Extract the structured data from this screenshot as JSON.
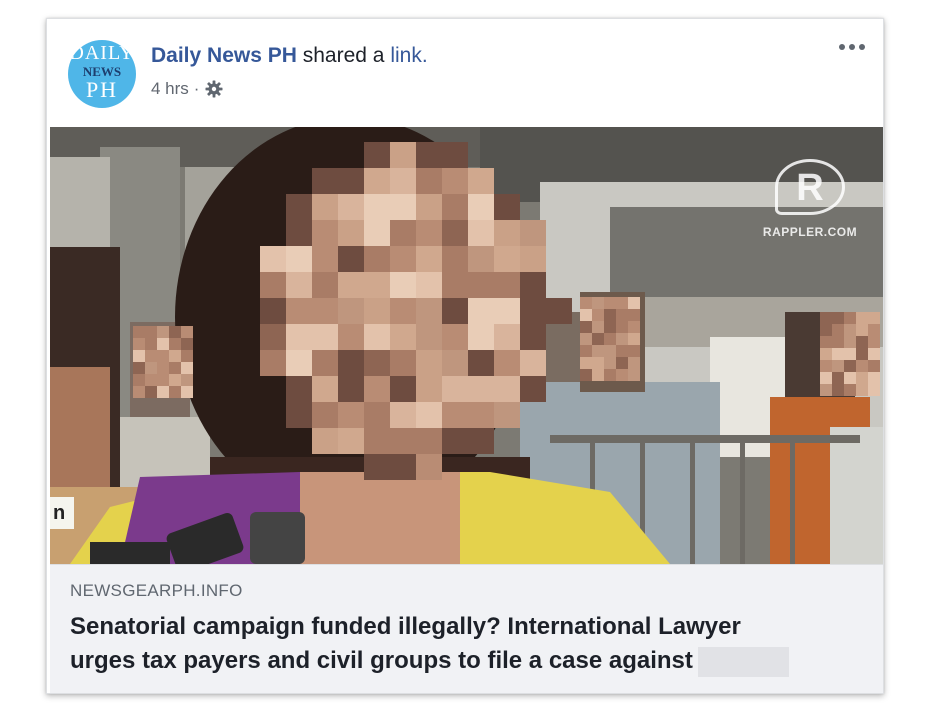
{
  "post": {
    "author_name": "Daily News PH",
    "action_text": "shared a ",
    "action_link": "link.",
    "timestamp": "4 hrs",
    "separator": "·",
    "privacy_icon": "gear-icon",
    "more_icon": "more-options-icon",
    "avatar": {
      "line1": "DAILY",
      "line2": "NEWS",
      "line3": "PH"
    }
  },
  "link_preview": {
    "watermark_text": "RAPPLER.COM",
    "watermark_letter": "R",
    "corner_label": "n",
    "domain": "NEWSGEARPH.INFO",
    "headline_line1": "Senatorial campaign funded illegally? International Lawyer",
    "headline_line2": "urges tax payers and civil groups to file a case against"
  },
  "colors": {
    "link_blue": "#365899",
    "text_dark": "#1d2129",
    "meta_grey": "#616770",
    "caption_bg": "#f1f2f5"
  }
}
